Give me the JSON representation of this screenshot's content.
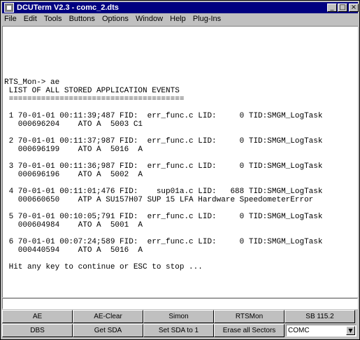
{
  "window": {
    "title": "DCUTerm V2.3 - comc_2.dts",
    "min_glyph": "_",
    "max_glyph": "□",
    "close_glyph": "×"
  },
  "menu": [
    "File",
    "Edit",
    "Tools",
    "Buttons",
    "Options",
    "Window",
    "Help",
    "Plug-Ins"
  ],
  "terminal": {
    "lines": [
      "RTS_Mon-> ae",
      " LIST OF ALL STORED APPLICATION EVENTS",
      " ======================================",
      "",
      " 1 70-01-01 00:11:39;487 FID:  err_func.c LID:     0 TID:SMGM_LogTask",
      "   000696204    ATO A  5003 C1",
      "",
      " 2 70-01-01 00:11:37;987 FID:  err_func.c LID:     0 TID:SMGM_LogTask",
      "   000696199    ATO A  5016  A",
      "",
      " 3 70-01-01 00:11:36;987 FID:  err_func.c LID:     0 TID:SMGM_LogTask",
      "   000696196    ATO A  5002  A",
      "",
      " 4 70-01-01 00:11:01;476 FID:    sup01a.c LID:   688 TID:SMGM_LogTask",
      "   000660650    ATP A SU157H07 SUP 15 LFA Hardware SpeedometerError",
      "",
      " 5 70-01-01 00:10:05;791 FID:  err_func.c LID:     0 TID:SMGM_LogTask",
      "   000604984    ATO A  5001  A",
      "",
      " 6 70-01-01 00:07:24;589 FID:  err_func.c LID:     0 TID:SMGM_LogTask",
      "   000440594    ATO A  5016  A",
      "",
      " Hit any key to continue or ESC to stop ..."
    ]
  },
  "buttons": {
    "row1": [
      "AE",
      "AE-Clear",
      "Simon",
      "RTSMon",
      "SB 115.2"
    ],
    "row2": [
      "DBS",
      "Get SDA",
      "Set SDA to 1",
      "Erase all Sectors"
    ]
  },
  "port_select": {
    "value": "COMC",
    "arrow": "▼"
  }
}
